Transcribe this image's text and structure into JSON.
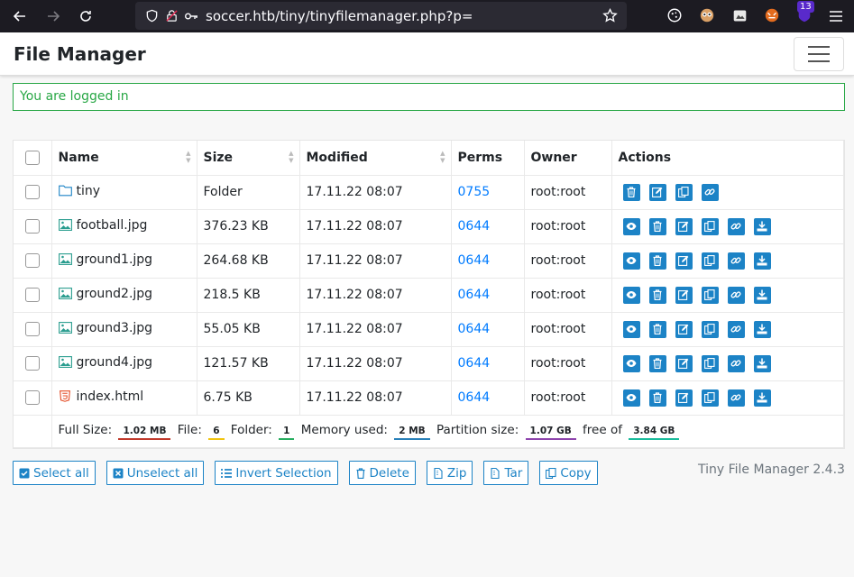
{
  "browser": {
    "url": "soccer.htb/tiny/tinyfilemanager.php?p=",
    "badge_count": "13"
  },
  "navbar": {
    "brand": "File Manager"
  },
  "alert": {
    "text": "You are logged in"
  },
  "table": {
    "headers": [
      "Name",
      "Size",
      "Modified",
      "Perms",
      "Owner",
      "Actions"
    ],
    "rows": [
      {
        "name": "tiny",
        "type": "folder",
        "size": "Folder",
        "modified": "17.11.22 08:07",
        "perms": "0755",
        "owner": "root:root"
      },
      {
        "name": "football.jpg",
        "type": "image",
        "size": "376.23 KB",
        "modified": "17.11.22 08:07",
        "perms": "0644",
        "owner": "root:root"
      },
      {
        "name": "ground1.jpg",
        "type": "image",
        "size": "264.68 KB",
        "modified": "17.11.22 08:07",
        "perms": "0644",
        "owner": "root:root"
      },
      {
        "name": "ground2.jpg",
        "type": "image",
        "size": "218.5 KB",
        "modified": "17.11.22 08:07",
        "perms": "0644",
        "owner": "root:root"
      },
      {
        "name": "ground3.jpg",
        "type": "image",
        "size": "55.05 KB",
        "modified": "17.11.22 08:07",
        "perms": "0644",
        "owner": "root:root"
      },
      {
        "name": "ground4.jpg",
        "type": "image",
        "size": "121.57 KB",
        "modified": "17.11.22 08:07",
        "perms": "0644",
        "owner": "root:root"
      },
      {
        "name": "index.html",
        "type": "html",
        "size": "6.75 KB",
        "modified": "17.11.22 08:07",
        "perms": "0644",
        "owner": "root:root"
      }
    ],
    "summary": {
      "full_size_label": "Full Size:",
      "full_size": "1.02 MB",
      "file_label": "File:",
      "file": "6",
      "folder_label": "Folder:",
      "folder": "1",
      "memory_label": "Memory used:",
      "memory": "2 MB",
      "partition_label": "Partition size:",
      "partition": "1.07 GB",
      "free_of_label": "free of",
      "free_of": "3.84 GB"
    }
  },
  "bottom": {
    "select_all": "Select all",
    "unselect_all": "Unselect all",
    "invert": "Invert Selection",
    "delete": "Delete",
    "zip": "Zip",
    "tar": "Tar",
    "copy": "Copy",
    "version": "Tiny File Manager 2.4.3"
  },
  "colors": {
    "accent": "#1c83c6",
    "link": "#007bff",
    "success": "#28a745",
    "chrome_bg": "#1c1b22",
    "stat_full": "#c0392b",
    "stat_file": "#f1c40f",
    "stat_folder": "#27ae60",
    "stat_memory": "#2980b9",
    "stat_partition": "#8e44ad",
    "stat_free": "#1abc9c"
  }
}
